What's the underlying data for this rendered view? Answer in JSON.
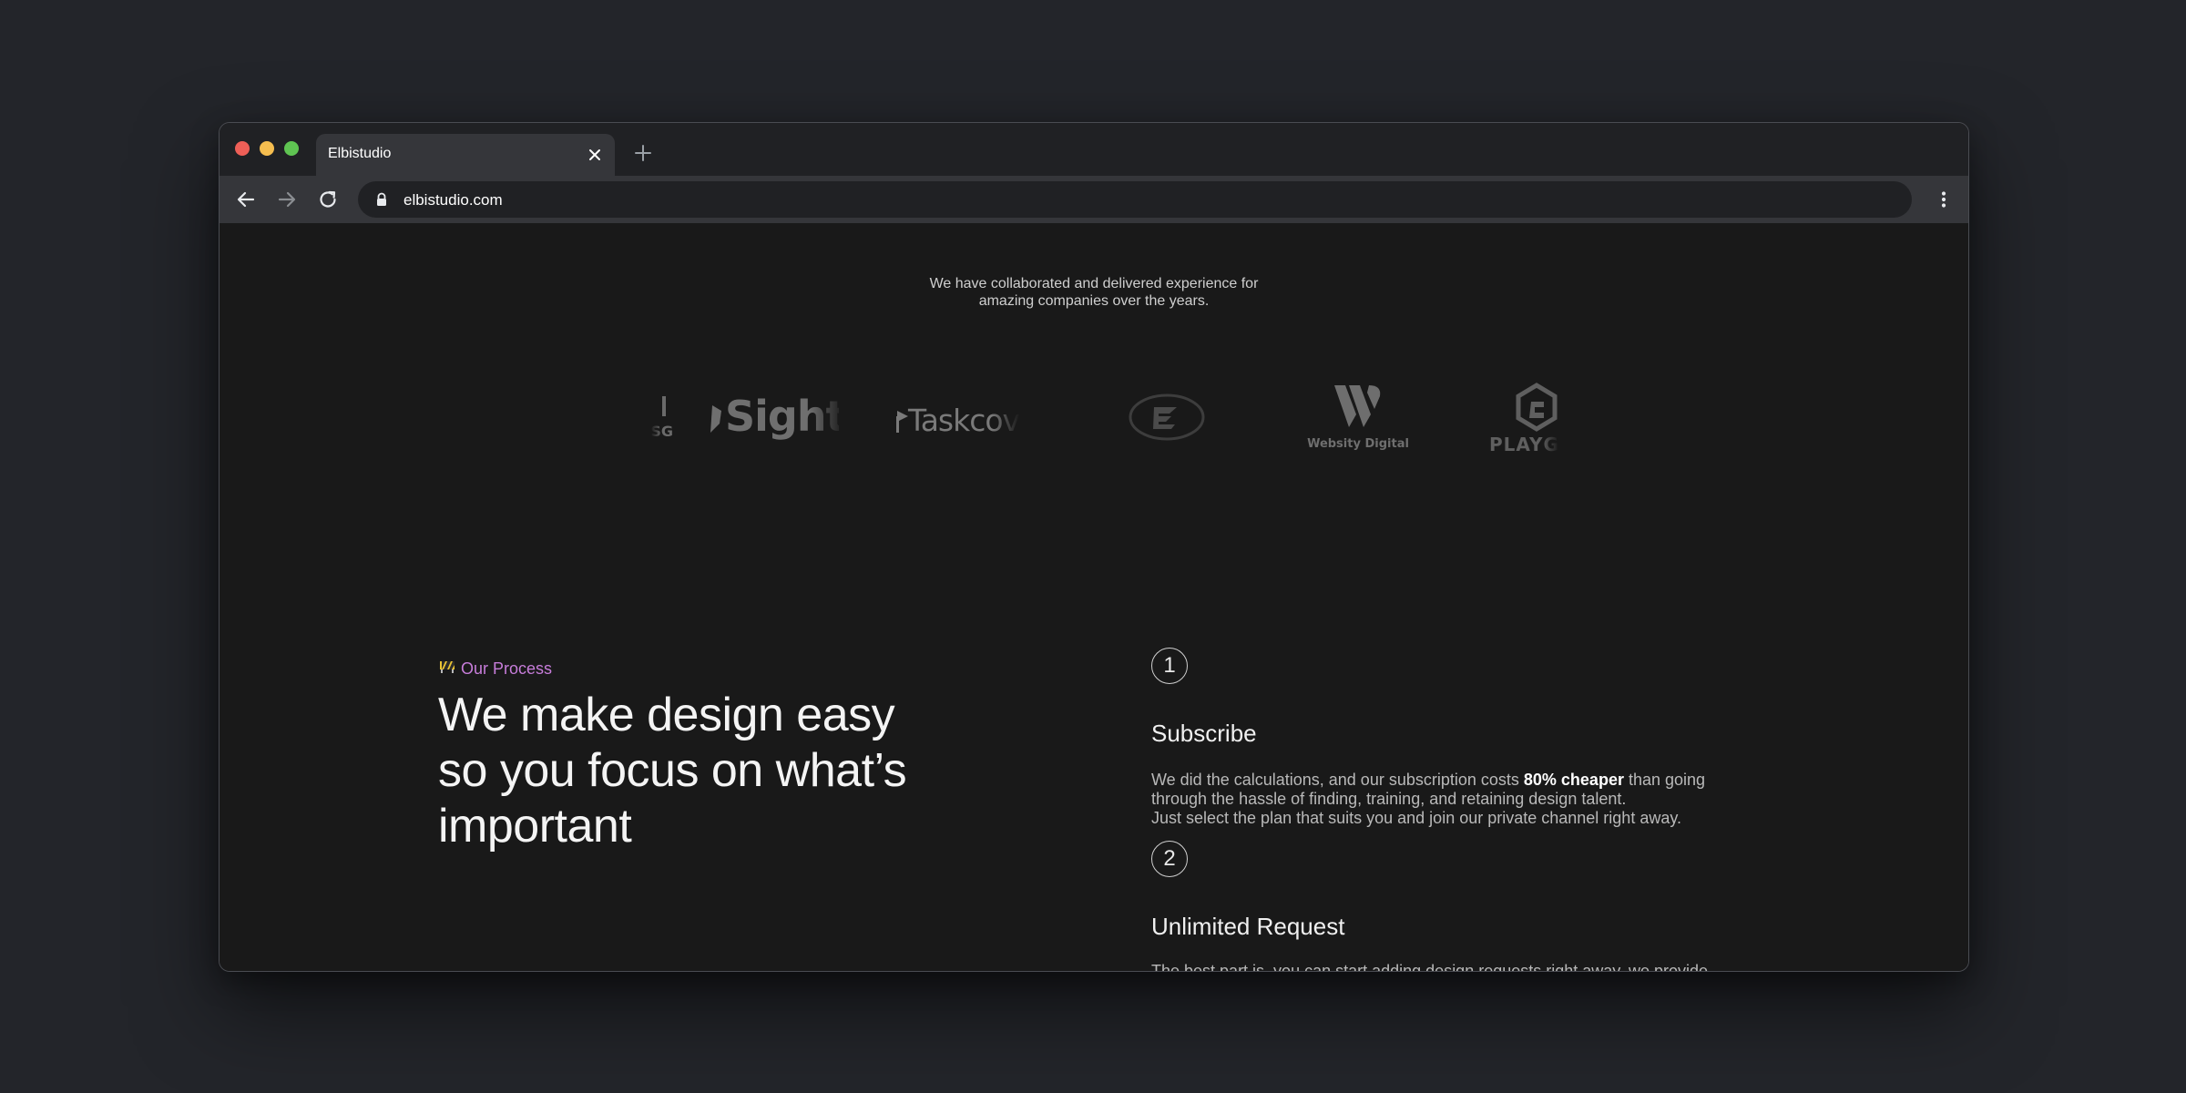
{
  "browser": {
    "tab_title": "Elbistudio",
    "url": "elbistudio.com",
    "icons": [
      "close-icon",
      "plus-icon",
      "back-arrow-icon",
      "forward-arrow-icon",
      "reload-icon",
      "lock-icon",
      "kebab-menu-icon"
    ]
  },
  "clients": {
    "intro_line1": "We have collaborated and delivered experience for",
    "intro_line2": "amazing companies over the years.",
    "logos": [
      "SG",
      "Sight",
      "Taskcov",
      "Websity Digital",
      "PLAYG"
    ]
  },
  "process": {
    "eyebrow_label": "Our Process",
    "headline_line1": "We make design easy",
    "headline_line2": "so you focus on what’s",
    "headline_line3": "important",
    "steps": [
      {
        "number": "1",
        "title": "Subscribe",
        "desc_pre": "We did the calculations, and our subscription costs ",
        "desc_bold": "80% cheaper",
        "desc_post": " than going",
        "desc_line2": "through the hassle of finding, training, and retaining design talent.",
        "desc_line3": "Just select the plan that suits you and join our private channel right away."
      },
      {
        "number": "2",
        "title": "Unlimited Request",
        "desc_line1": "The best part is, you can start adding design requests right away, we provide"
      }
    ]
  },
  "colors": {
    "page_bg": "#23252a",
    "content_bg": "#191919",
    "accent_purple": "#c77dda",
    "traffic_red": "#ee5f57",
    "traffic_yellow": "#f5bd4f",
    "traffic_green": "#5fc452"
  }
}
